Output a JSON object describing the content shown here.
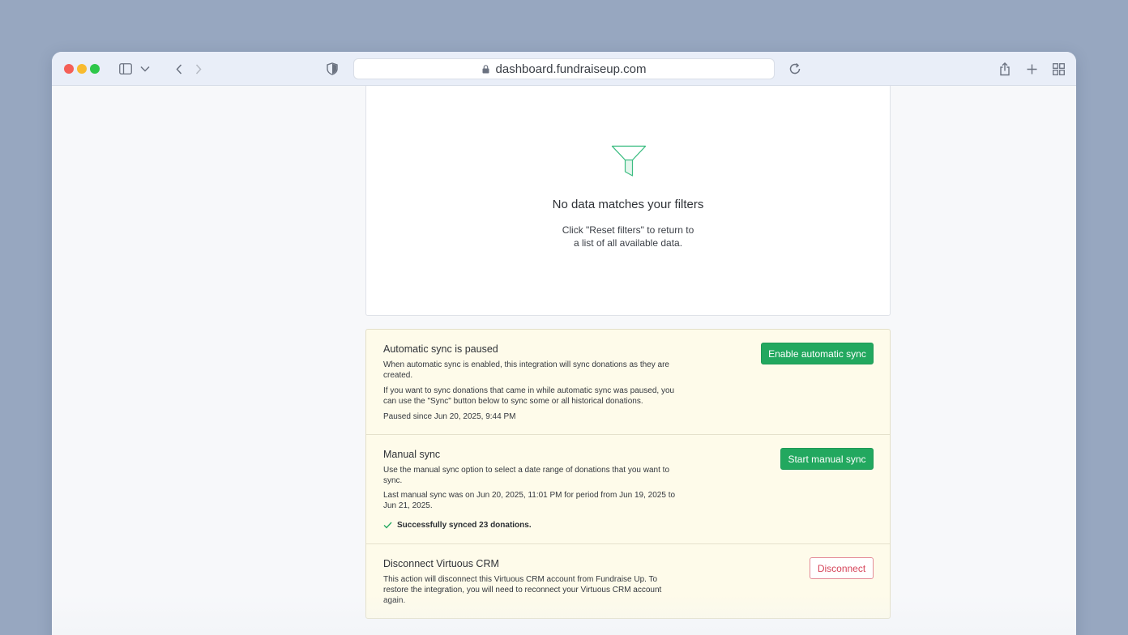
{
  "browser": {
    "url": "dashboard.fundraiseup.com",
    "icons": {
      "sidebar": "sidebar-icon",
      "tab_menu": "chevron-down-icon",
      "back": "chevron-left-icon",
      "forward": "chevron-right-icon",
      "privacy": "shield-icon",
      "lock": "lock-icon",
      "reload": "reload-icon",
      "share": "share-icon",
      "new_tab": "plus-icon",
      "tab_overview": "grid-icon"
    }
  },
  "empty_state": {
    "icon": "funnel-icon",
    "title": "No data matches your filters",
    "description_line1": "Click \"Reset filters\" to return to",
    "description_line2": "a list of all available data."
  },
  "automatic_sync": {
    "title": "Automatic sync is paused",
    "text1": "When automatic sync is enabled, this integration will sync donations as they are created.",
    "text2": "If you want to sync donations that came in while automatic sync was paused, you can use the \"Sync\" button below to sync some or all historical donations.",
    "paused_since": "Paused since Jun 20, 2025, 9:44 PM",
    "button_label": "Enable automatic sync"
  },
  "manual_sync": {
    "title": "Manual sync",
    "text1": "Use the manual sync option to select a date range of donations that you want to sync.",
    "text2": "Last manual sync was on Jun 20, 2025, 11:01 PM for period from Jun 19, 2025 to Jun 21, 2025.",
    "success": "Successfully synced 23 donations.",
    "button_label": "Start manual sync"
  },
  "disconnect": {
    "title": "Disconnect Virtuous CRM",
    "text": "This action will disconnect this Virtuous CRM account from Fundraise Up. To restore the integration, you will need to reconnect your Virtuous CRM account again.",
    "button_label": "Disconnect"
  },
  "colors": {
    "primary_green": "#22a85f",
    "danger_red": "#d6455a",
    "warning_bg": "#fefbea",
    "funnel_stroke": "#3dbd82"
  }
}
